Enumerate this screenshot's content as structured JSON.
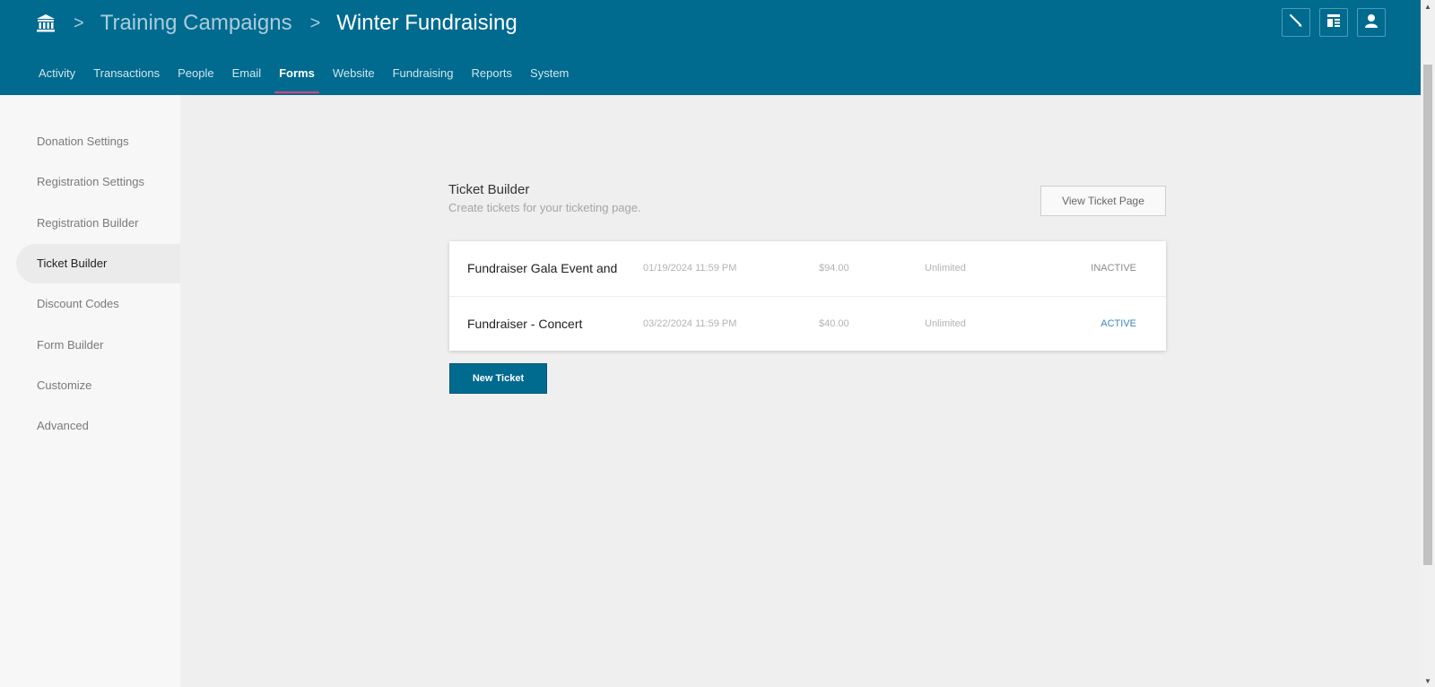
{
  "breadcrumb": {
    "home_icon": "institution-icon",
    "separator": ">",
    "parent": "Training Campaigns",
    "current": "Winter Fundraising"
  },
  "tools": [
    {
      "icon": "pen-icon"
    },
    {
      "icon": "layout-icon"
    },
    {
      "icon": "user-icon"
    }
  ],
  "nav": {
    "items": [
      "Activity",
      "Transactions",
      "People",
      "Email",
      "Forms",
      "Website",
      "Fundraising",
      "Reports",
      "System"
    ],
    "active": "Forms"
  },
  "sidebar": {
    "items": [
      "Donation Settings",
      "Registration Settings",
      "Registration Builder",
      "Ticket Builder",
      "Discount Codes",
      "Form Builder",
      "Customize",
      "Advanced"
    ],
    "active": "Ticket Builder"
  },
  "main": {
    "title": "Ticket Builder",
    "subtitle": "Create tickets for your ticketing page.",
    "view_button": "View Ticket Page",
    "new_button": "New Ticket"
  },
  "tickets": [
    {
      "name": "Fundraiser Gala Event and D",
      "date": "01/19/2024 11:59 PM",
      "price": "$94.00",
      "quantity": "Unlimited",
      "status": "INACTIVE"
    },
    {
      "name": "Fundraiser - Concert",
      "date": "03/22/2024 11:59 PM",
      "price": "$40.00",
      "quantity": "Unlimited",
      "status": "ACTIVE"
    }
  ],
  "colors": {
    "header": "#006a8f",
    "active_tab_underline": "#e5417c",
    "active_status": "#3a86b7"
  }
}
